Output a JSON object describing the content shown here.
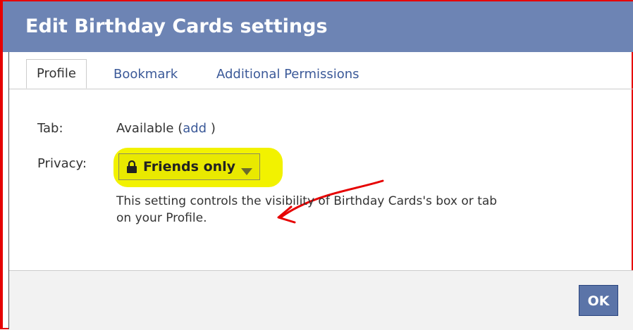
{
  "dialog": {
    "title": "Edit Birthday Cards settings",
    "tabs": [
      {
        "label": "Profile",
        "active": true
      },
      {
        "label": "Bookmark",
        "active": false
      },
      {
        "label": "Additional Permissions",
        "active": false
      }
    ],
    "tab_row": {
      "label": "Tab:",
      "value": "Available (",
      "link": "add",
      "suffix": " )"
    },
    "privacy_row": {
      "label": "Privacy:",
      "selected": "Friends only",
      "icon": "lock-icon",
      "help_text": "This setting controls the visibility of Birthday Cards's box or tab on your Profile."
    },
    "ok_label": "OK"
  },
  "colors": {
    "header": "#6d84b4",
    "link": "#3b5998",
    "highlight": "#f2f200",
    "annotation": "#e60000"
  }
}
